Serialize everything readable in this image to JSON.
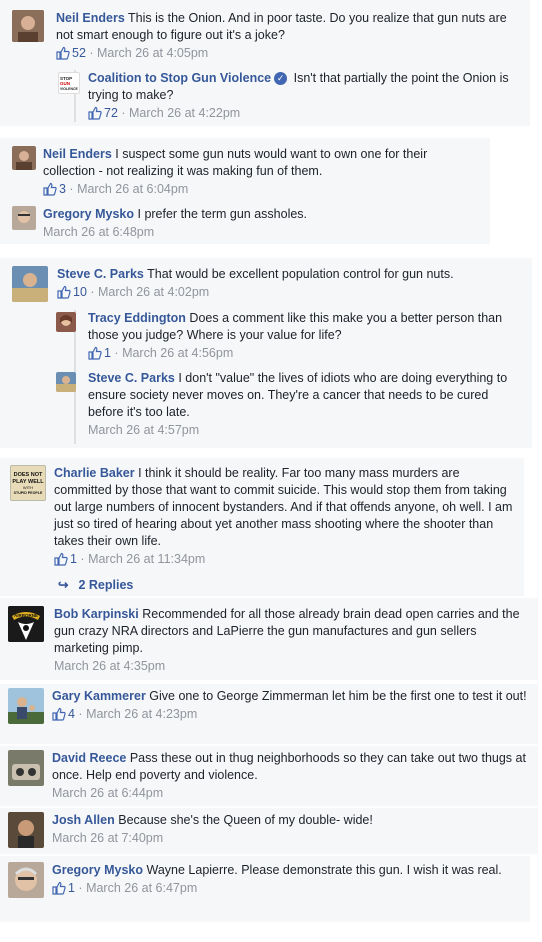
{
  "ui": {
    "like_icon": "thumbs-up-icon",
    "link_color": "#365899",
    "meta_color": "#90949c",
    "background": "#f6f7f9"
  },
  "threads": [
    {
      "name": "Neil Enders",
      "text": "This is the Onion. And in poor taste. Do you realize that gun nuts are not smart enough to figure out it's a joke?",
      "likes": "52",
      "date": "March 26 at 4:05pm",
      "reply": {
        "name": "Coalition to Stop Gun Violence",
        "avatar_text": "STOP GUN VIOLENCE",
        "text": "Isn't that partially the point the Onion is trying to make?",
        "likes": "72",
        "date": "March 26 at 4:22pm"
      }
    },
    {
      "name": "Neil Enders",
      "text": "I suspect some gun nuts would want to own one for their collection - not realizing it was making fun of them.",
      "likes": "3",
      "date": "March 26 at 6:04pm",
      "reply": {
        "name": "Gregory Mysko",
        "text": "I prefer the term gun assholes.",
        "date": "March 26 at 6:48pm"
      }
    },
    {
      "name": "Steve C. Parks",
      "text": "That would be excellent population control for gun nuts.",
      "likes": "10",
      "date": "March 26 at 4:02pm",
      "replies": [
        {
          "name": "Tracy Eddington",
          "text": "Does a comment like this make you a better person than those you judge? Where is your value for life?",
          "likes": "1",
          "date": "March 26 at 4:56pm"
        },
        {
          "name": "Steve C. Parks",
          "text": "I don't \"value\" the lives of idiots who are doing everything to ensure society never moves on. They're a cancer that needs to be cured before it's too late.",
          "date": "March 26 at 4:57pm"
        }
      ]
    },
    {
      "name": "Charlie Baker",
      "avatar_text": "DOES NOT PLAY WELL WITH STUPID PEOPLE",
      "text": "I think it should be reality. Far too many mass murders are committed by those that want to commit suicide. This would stop them from taking out large numbers of innocent bystanders. And if that offends anyone, oh well. I am just so tired of hearing about yet another mass shooting where the shooter than takes their own life.",
      "likes": "1",
      "date": "March 26 at 11:34pm",
      "replies_label": "2 Replies"
    },
    {
      "name": "Bob Karpinski",
      "avatar_text": "AIRBORNE",
      "text": "Recommended for all those already brain dead open carries and the gun crazy NRA directors and LaPierre the gun manufactures and gun sellers marketing pimp.",
      "date": "March 26 at 4:35pm"
    },
    {
      "name": "Gary Kammerer",
      "text": "Give one to George Zimmerman let him be the first one to test it out!",
      "likes": "4",
      "date": "March 26 at 4:23pm"
    },
    {
      "name": "David Reece",
      "text": "Pass these out in thug neighborhoods so they can take out two thugs at once. Help end poverty and violence.",
      "date": "March 26 at 6:44pm"
    },
    {
      "name": "Josh Allen",
      "text": "Because she's the Queen of my double- wide!",
      "date": "March 26 at 7:40pm"
    },
    {
      "name": "Gregory Mysko",
      "text": "Wayne Lapierre. Please demonstrate this gun. I wish it was real.",
      "likes": "1",
      "date": "March 26 at 6:47pm"
    }
  ]
}
